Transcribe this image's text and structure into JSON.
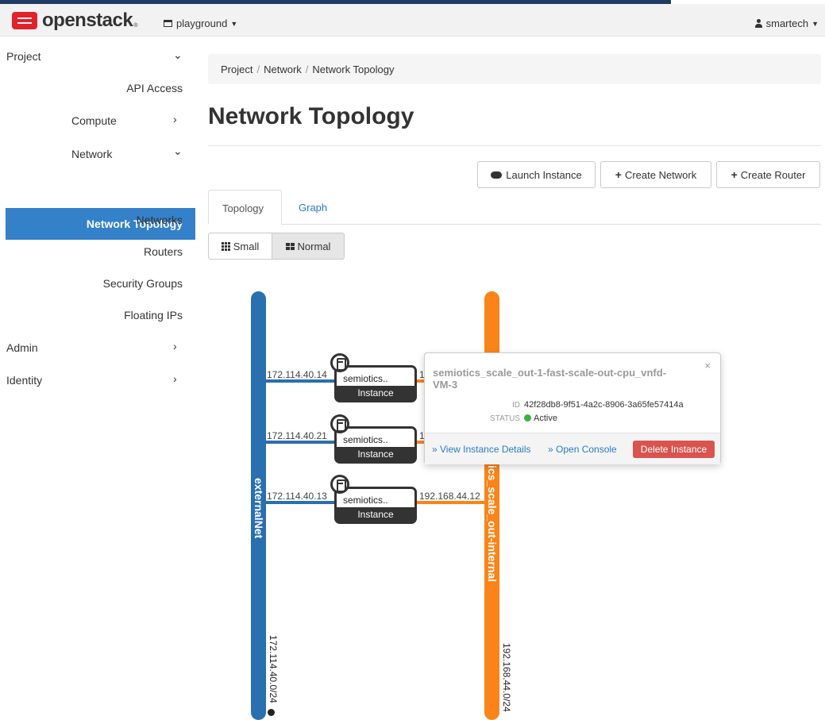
{
  "navbar": {
    "brand": "openstack",
    "brand_sup": "®",
    "project": "playground",
    "user": "smartech"
  },
  "sidebar": {
    "project": "Project",
    "api_access": "API Access",
    "compute": "Compute",
    "network": "Network",
    "network_topology": "Network Topology",
    "networks": "Networks",
    "routers": "Routers",
    "security_groups": "Security Groups",
    "floating_ips": "Floating IPs",
    "admin": "Admin",
    "identity": "Identity"
  },
  "breadcrumb": {
    "project": "Project",
    "network": "Network",
    "current": "Network Topology",
    "sep": "/"
  },
  "page_title": "Network Topology",
  "actions": {
    "launch": "Launch Instance",
    "create_network": "Create Network",
    "create_router": "Create Router"
  },
  "tabs": {
    "topology": "Topology",
    "graph": "Graph"
  },
  "size_toggle": {
    "small": "Small",
    "normal": "Normal"
  },
  "topology": {
    "external": {
      "name": "externalNet",
      "cidr": "172.114.40.0/24"
    },
    "internal": {
      "name": "semiotics_scale_out-internal",
      "name_visible": "ics_scale_out-internal",
      "cidr": "192.168.44.0/24"
    },
    "instances": [
      {
        "name": "semiotics..",
        "type": "Instance",
        "ext_ip": "172.114.40.14",
        "int_ip": "1"
      },
      {
        "name": "semiotics..",
        "type": "Instance",
        "ext_ip": "172.114.40.21",
        "int_ip": "1"
      },
      {
        "name": "semiotics..",
        "type": "Instance",
        "ext_ip": "172.114.40.13",
        "int_ip": "192.168.44.12"
      }
    ]
  },
  "popover": {
    "title": "semiotics_scale_out-1-fast-scale-out-cpu_vnfd-VM-3",
    "close": "×",
    "id_label": "ID",
    "id_value": "42f28db8-9f51-4a2c-8906-3a65fe57414a",
    "status_label": "STATUS",
    "status_value": "Active",
    "view_details": "» View Instance Details",
    "open_console": "» Open Console",
    "delete": "Delete Instance"
  }
}
